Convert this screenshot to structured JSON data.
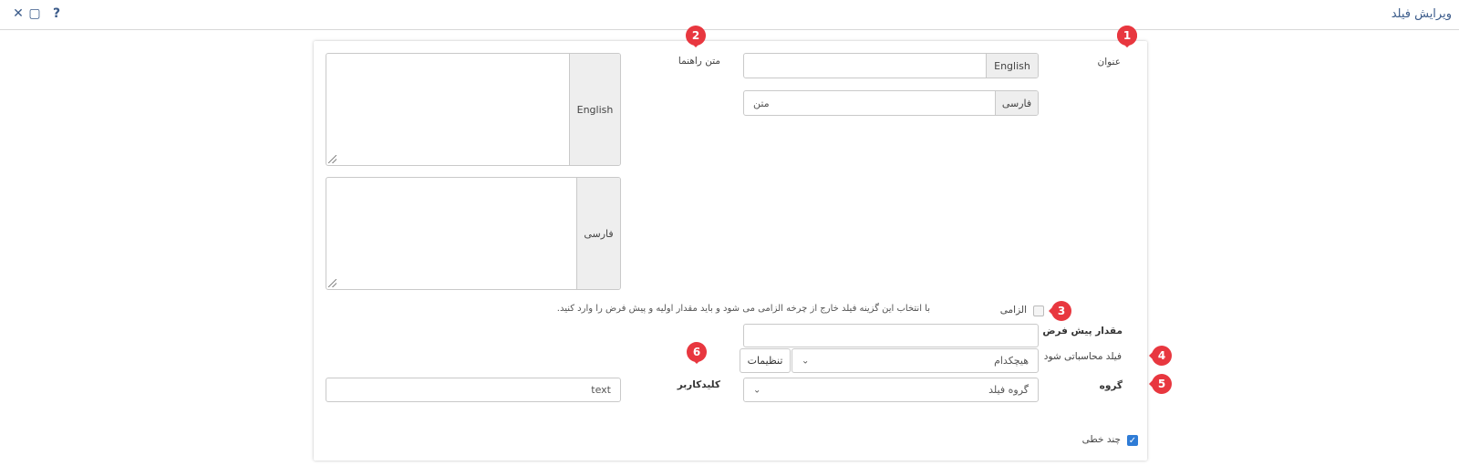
{
  "window": {
    "title": "ویرایش فیلد",
    "help_icon": "?",
    "maximize_icon": "▢",
    "close_icon": "✕"
  },
  "form": {
    "title_label": "عنوان",
    "title_en_addon": "English",
    "title_en_value": "",
    "title_fa_addon": "فارسی",
    "title_fa_value": "متن",
    "help_label": "متن راهنما",
    "help_en_addon": "English",
    "help_fa_addon": "فارسی",
    "required_label": "الزامی",
    "required_hint": "با انتخاب این گزینه فیلد خارج از چرخه الزامی می شود و باید مقدار اولیه و پیش فرض را وارد کنید.",
    "default_label": "مقدار پیش فرض",
    "default_value": "",
    "computed_label": "فیلد محاسباتی شود",
    "computed_value": "هیچکدام",
    "settings_button": "تنظیمات",
    "group_label": "گروه",
    "group_value": "گروه فیلد",
    "keyword_label": "کلیدکاربر",
    "keyword_value": "text",
    "multiline_label": "چند خطی",
    "multiline_checked": true,
    "required_checked": false
  },
  "markers": [
    "1",
    "2",
    "3",
    "4",
    "5",
    "6"
  ],
  "colors": {
    "accent": "#3b5b8a",
    "marker": "#e8373f",
    "checkbox": "#2f7cd6"
  }
}
